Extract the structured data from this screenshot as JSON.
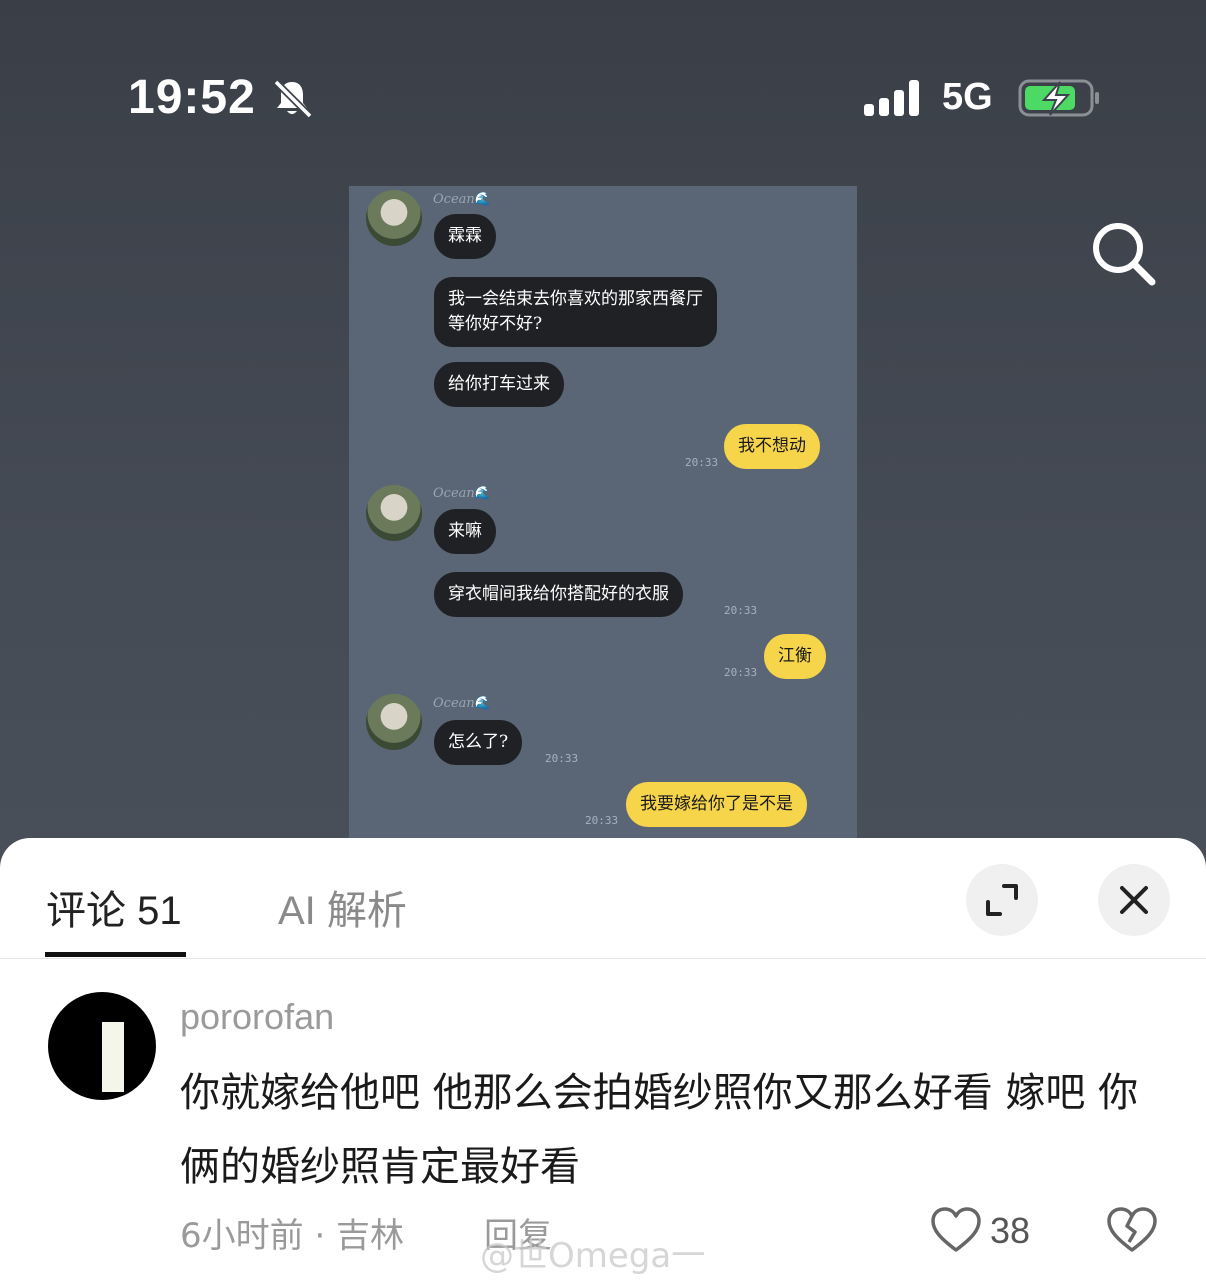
{
  "status_bar": {
    "time": "19:52",
    "network": "5G"
  },
  "chat": {
    "sender_name": "Ocean",
    "sender_emoji": "🌊",
    "messages": [
      {
        "from": "other",
        "text": "霖霖"
      },
      {
        "from": "other",
        "text": "我一会结束去你喜欢的那家西餐厅"
      },
      {
        "from": "other",
        "text": "等你好不好?"
      },
      {
        "from": "other",
        "text": "给你打车过来"
      },
      {
        "from": "me",
        "text": "我不想动",
        "time": "20:33"
      },
      {
        "from": "other",
        "text": "来嘛"
      },
      {
        "from": "other",
        "text": "穿衣帽间我给你搭配好的衣服",
        "time": "20:33"
      },
      {
        "from": "me",
        "text": "江衡",
        "time": "20:33"
      },
      {
        "from": "other",
        "text": "怎么了?",
        "time": "20:33"
      },
      {
        "from": "me",
        "text": "我要嫁给你了是不是",
        "time": "20:33"
      }
    ]
  },
  "comments_panel": {
    "tabs": [
      {
        "label": "评论 51"
      },
      {
        "label": "AI 解析"
      }
    ],
    "comment": {
      "username": "pororofan",
      "text": "你就嫁给他吧 他那么会拍婚纱照你又那么好看 嫁吧 你俩的婚纱照肯定最好看",
      "meta": "6小时前 · 吉林",
      "reply_label": "回复",
      "likes": "38"
    },
    "watermark": "@世Omega一"
  },
  "colors": {
    "me_bubble": "#f6d54a",
    "other_bubble": "#1f2124",
    "chat_bg": "#5a6676"
  }
}
